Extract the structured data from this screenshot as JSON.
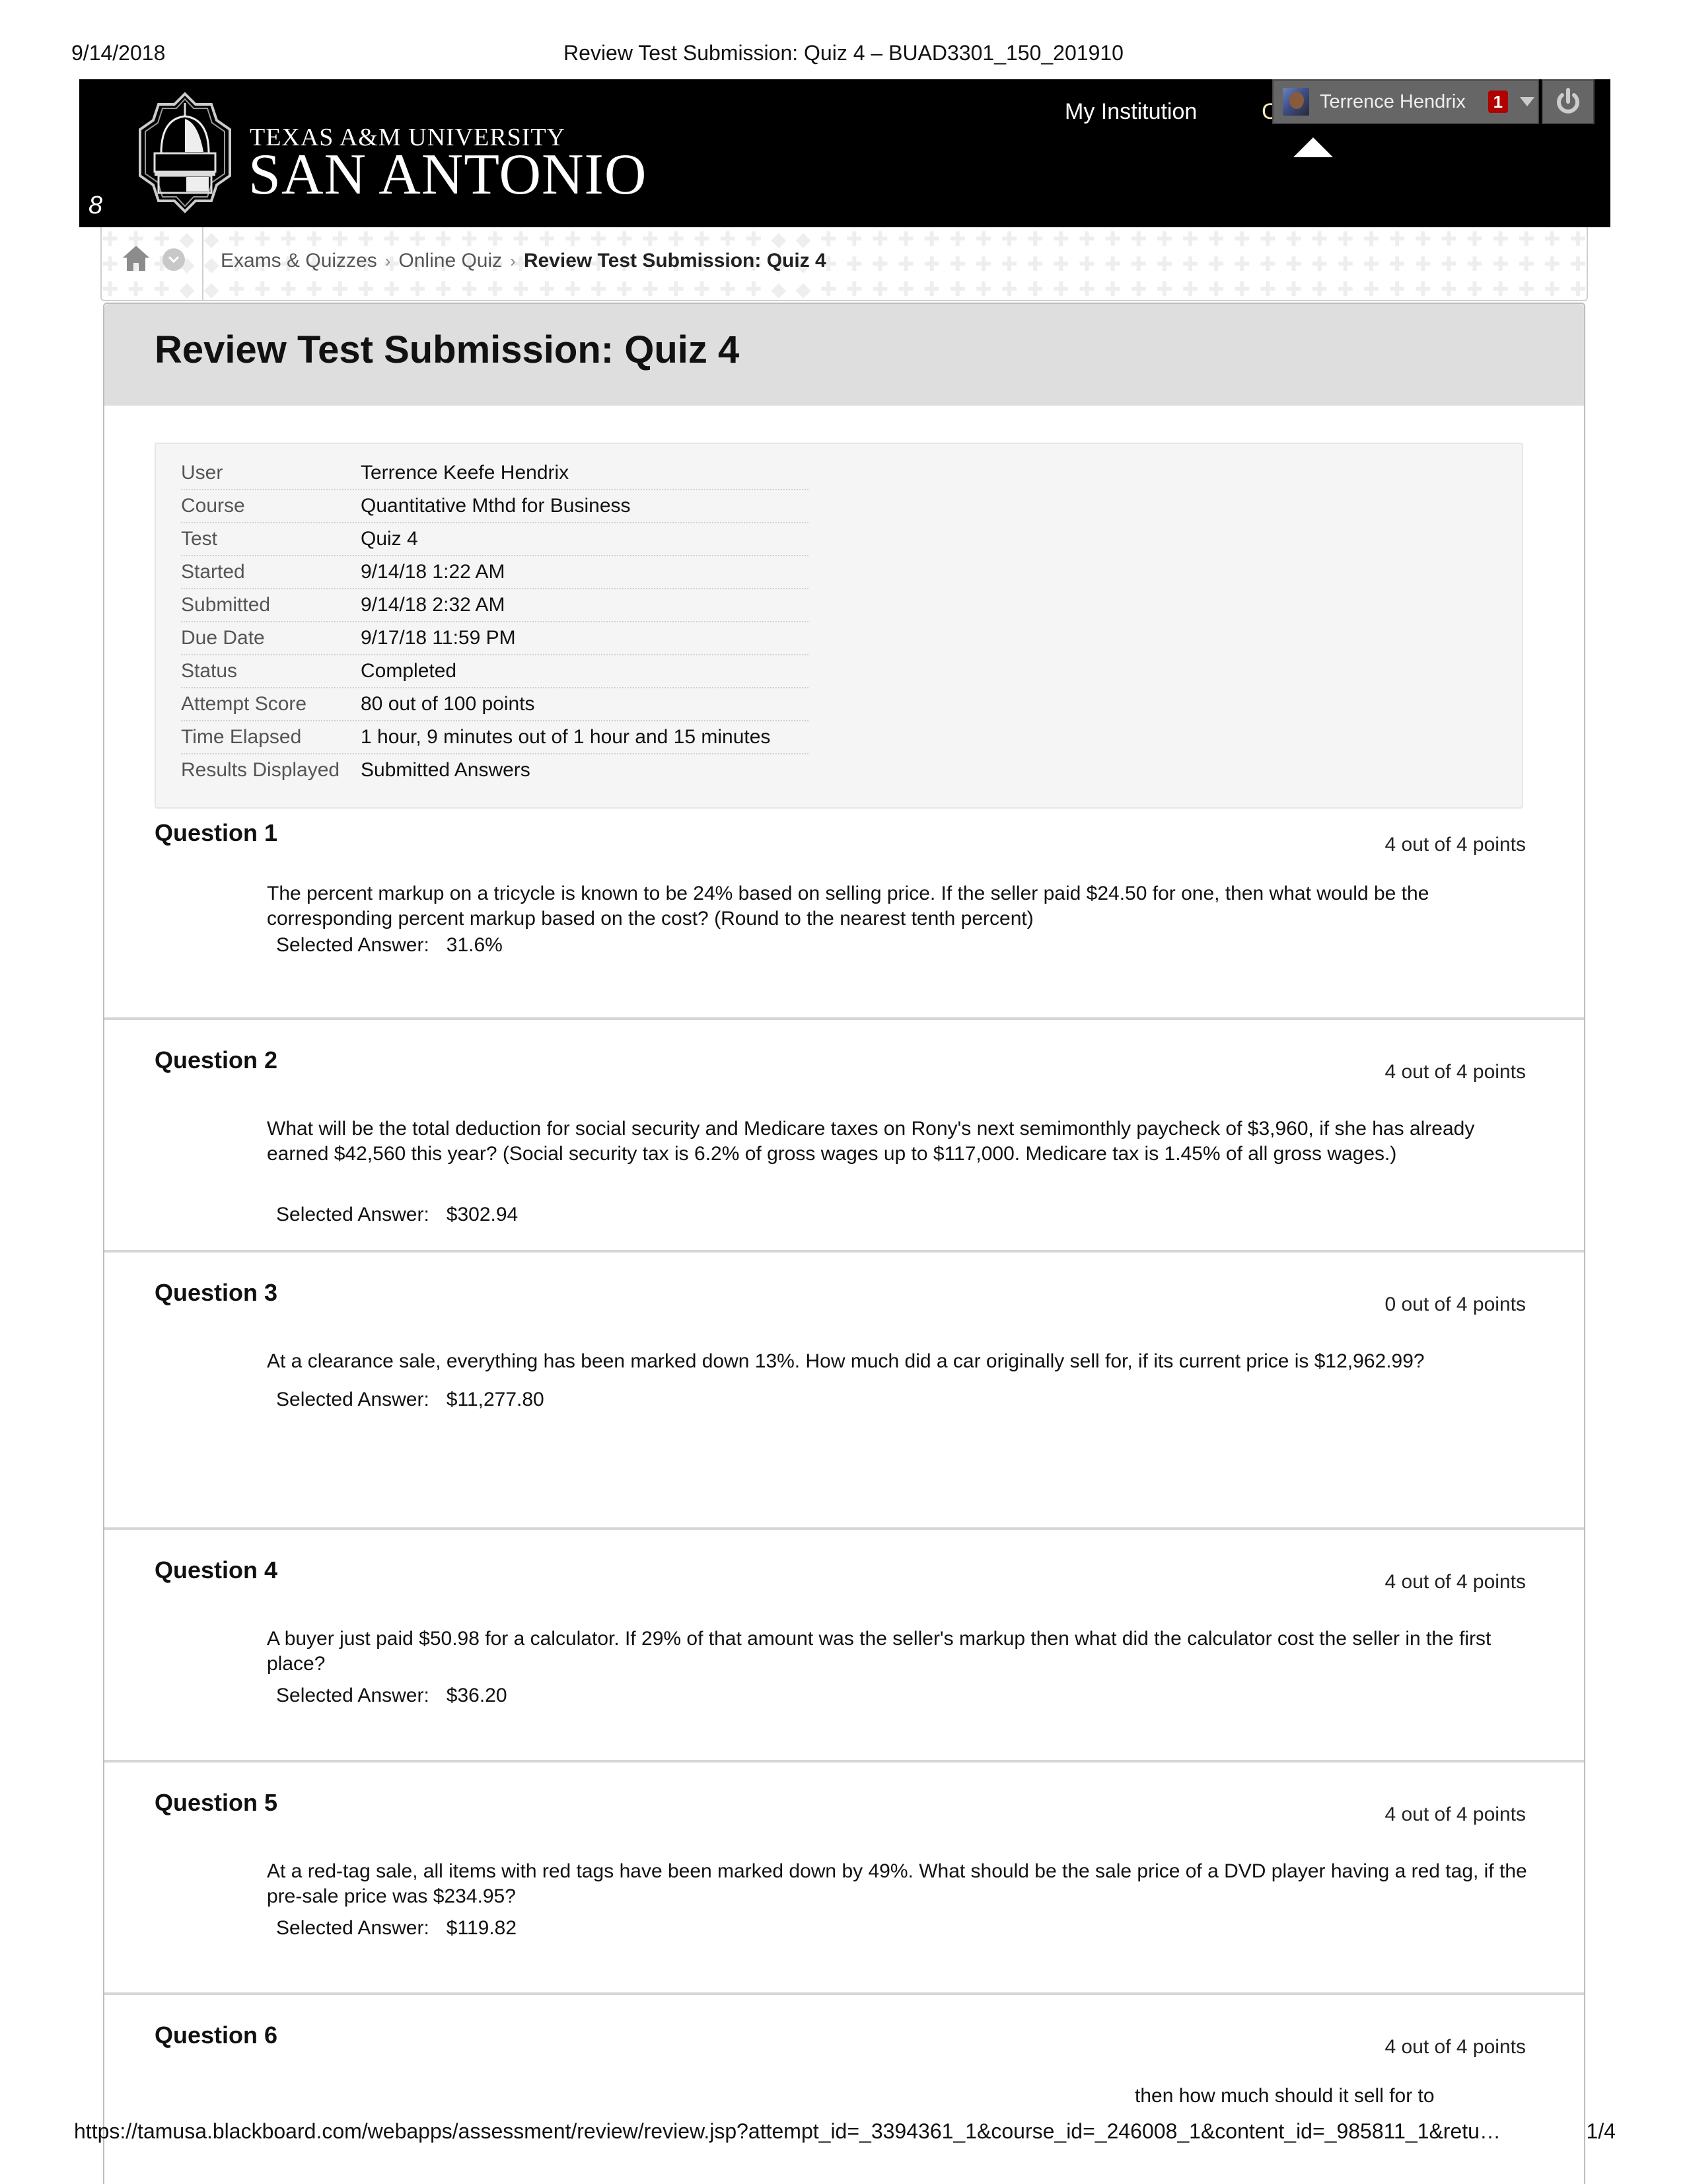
{
  "print": {
    "date": "9/14/2018",
    "title": "Review Test Submission: Quiz 4 – BUAD3301_150_201910",
    "url": "https://tamusa.blackboard.com/webapps/assessment/review/review.jsp?attempt_id=_3394361_1&course_id=_246008_1&content_id=_985811_1&retu…",
    "page": "1/4"
  },
  "banner": {
    "logo_line1": "TEXAS A&M UNIVERSITY",
    "logo_line2": "SAN ANTONIO",
    "glyph": "8",
    "nav_my_institution": "My Institution",
    "nav_partial": "C",
    "user_name": "Terrence Hendrix",
    "notification_count": "1",
    "colors": {
      "banner_bg": "#000000",
      "badge": "#b00000",
      "user_menu": "#666666"
    }
  },
  "breadcrumb": {
    "pattern": "✚✚✚◆◆✚✚✚✚✚✚✚✚✚✚✚✚✚✚✚✚✚✚✚✚✚◆◆✚✚✚✚✚✚✚✚✚✚✚✚✚✚✚✚✚✚✚✚✚✚✚✚✚✚✚✚✚✚✚✚",
    "items": [
      "Exams & Quizzes",
      "Online Quiz"
    ],
    "current": "Review Test Submission: Quiz 4"
  },
  "page": {
    "title": "Review Test Submission: Quiz 4"
  },
  "info": [
    {
      "label": "User",
      "value": "Terrence Keefe Hendrix"
    },
    {
      "label": "Course",
      "value": "Quantitative Mthd for Business"
    },
    {
      "label": "Test",
      "value": "Quiz 4"
    },
    {
      "label": "Started",
      "value": "9/14/18 1:22 AM"
    },
    {
      "label": "Submitted",
      "value": "9/14/18 2:32 AM"
    },
    {
      "label": "Due Date",
      "value": "9/17/18 11:59 PM"
    },
    {
      "label": "Status",
      "value": "Completed"
    },
    {
      "label": "Attempt Score",
      "value": "80 out of 100 points"
    },
    {
      "label": "Time Elapsed",
      "value": "1 hour, 9 minutes out of 1 hour and 15 minutes"
    },
    {
      "label": "Results Displayed",
      "value": "Submitted Answers"
    }
  ],
  "answer_label": "Selected Answer:",
  "questions": [
    {
      "title": "Question 1",
      "points": "4 out of 4 points",
      "text": "The percent markup on a tricycle is known to be 24% based on selling price. If the seller paid $24.50 for one, then what would be the corresponding percent markup based on the cost? (Round to the nearest tenth percent)",
      "answer": "31.6%"
    },
    {
      "title": "Question 2",
      "points": "4 out of 4 points",
      "text": "What will be the total deduction for social security and Medicare taxes on Rony's next semimonthly paycheck of $3,960, if she has already earned $42,560 this year? (Social security tax is 6.2% of gross wages up to $117,000. Medicare tax is 1.45% of all gross wages.)",
      "answer": "$302.94"
    },
    {
      "title": "Question 3",
      "points": "0 out of 4 points",
      "text": "At a clearance sale, everything has been marked down 13%. How much did a car originally sell for, if its current price is $12,962.99?",
      "answer": "$11,277.80"
    },
    {
      "title": "Question 4",
      "points": "4 out of 4 points",
      "text": "A buyer just paid $50.98 for a calculator. If 29% of that amount was the seller's markup then what did the calculator cost the seller in the first place?",
      "answer": "$36.20"
    },
    {
      "title": "Question 5",
      "points": "4 out of 4 points",
      "text": "At a red-tag sale, all items with red tags have been marked down by 49%. What should be the sale price of a DVD player having a red tag, if the pre-sale price was $234.95?",
      "answer": "$119.82"
    },
    {
      "title": "Question 6",
      "points": "4 out of 4 points",
      "text": "then how much should it sell for to"
    }
  ]
}
